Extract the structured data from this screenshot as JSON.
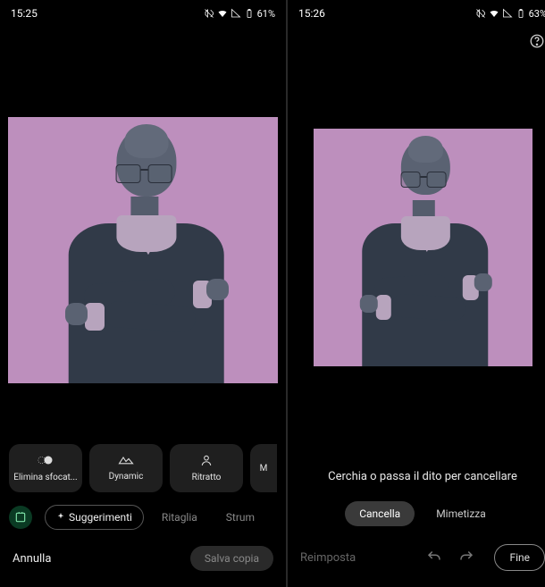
{
  "left": {
    "status": {
      "time": "15:25",
      "battery": "61%"
    },
    "suggestions": [
      {
        "id": "blur",
        "label": "Elimina sfocat..."
      },
      {
        "id": "dynamic",
        "label": "Dynamic"
      },
      {
        "id": "portrait",
        "label": "Ritratto"
      },
      {
        "id": "more",
        "label": "M"
      }
    ],
    "tabs": {
      "suggestions": "Suggerimenti",
      "crop": "Ritaglia",
      "tools": "Strum"
    },
    "actions": {
      "cancel": "Annulla",
      "save": "Salva copia"
    }
  },
  "right": {
    "status": {
      "time": "15:26",
      "battery": "63%"
    },
    "hint": "Cerchia o passa il dito per cancellare",
    "modes": {
      "erase": "Cancella",
      "camouflage": "Mimetizza"
    },
    "actions": {
      "reset": "Reimposta",
      "done": "Fine"
    }
  }
}
